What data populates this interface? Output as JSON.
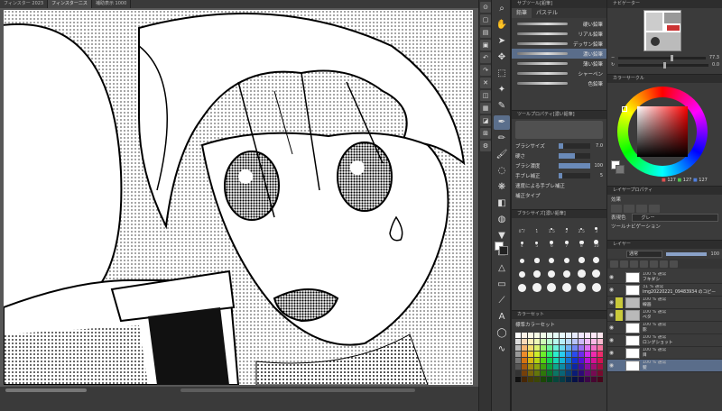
{
  "doc_tabs": [
    {
      "label": "フィンスター 2023"
    },
    {
      "label": "フィンスター二ス"
    },
    {
      "label": "補助表示 1000"
    }
  ],
  "subtool": {
    "header": "サブツール[鉛筆]",
    "tabs": [
      "鉛筆",
      "パステル"
    ],
    "brushes": [
      {
        "label": "硬い鉛筆"
      },
      {
        "label": "リアル鉛筆"
      },
      {
        "label": "デッサン鉛筆"
      },
      {
        "label": "濃い鉛筆"
      },
      {
        "label": "薄い鉛筆"
      },
      {
        "label": "シャーペン"
      },
      {
        "label": "色鉛筆"
      }
    ],
    "active_index": 3
  },
  "tool_property": {
    "header": "ツールプロパティ[濃い鉛筆]",
    "rows": [
      {
        "label": "ブラシサイズ",
        "value": "7.0",
        "fill": 0.15
      },
      {
        "label": "硬さ",
        "value": "",
        "fill": 0.5
      },
      {
        "label": "ブラシ濃度",
        "value": "100",
        "fill": 1.0
      },
      {
        "label": "手ブレ補正",
        "value": "5",
        "fill": 0.1
      },
      {
        "label": "速度による手ブレ補正",
        "value": "",
        "fill": 0
      },
      {
        "label": "補正タイプ",
        "value": "",
        "fill": 0
      }
    ]
  },
  "brush_size": {
    "header": "ブラシサイズ[濃い鉛筆]",
    "sizes": [
      "0.7",
      "1",
      "1.5",
      "2",
      "2.5",
      "3",
      "4",
      "5",
      "6",
      "7",
      "8",
      "10",
      "12",
      "15",
      "17",
      "20",
      "25",
      "30",
      "40",
      "50",
      "60",
      "70",
      "80",
      "100",
      "120",
      "150",
      "170",
      "200",
      "250",
      "300"
    ]
  },
  "color_set": {
    "header": "カラーセット",
    "name": "標準カラーセット"
  },
  "navigator": {
    "header": "ナビゲーター",
    "zoom": "77.3",
    "rotation": "0.0"
  },
  "color_wheel": {
    "header": "カラーサークル",
    "r": "127",
    "g": "127",
    "b": "127"
  },
  "layer_property": {
    "header": "レイヤープロパティ",
    "effect_label": "効果",
    "expression_label": "表現色",
    "expression_value": "グレー",
    "gradation_label": "ツールナビゲーション"
  },
  "layers": {
    "header": "レイヤー",
    "blend_mode": "通常",
    "opacity": "100",
    "items": [
      {
        "mode": "100 % 通常",
        "name": "フキダシ",
        "type": "layer",
        "selected": false
      },
      {
        "mode": "31 % 通常",
        "name": "img20220221_09483934 のコピー",
        "type": "image",
        "selected": false
      },
      {
        "mode": "100 % 通常",
        "name": "線画",
        "type": "folder",
        "selected": false
      },
      {
        "mode": "100 % 通常",
        "name": "ベタ",
        "type": "folder",
        "selected": false
      },
      {
        "mode": "100 % 通常",
        "name": "影",
        "type": "layer",
        "selected": false
      },
      {
        "mode": "100 % 通常",
        "name": "ロングショット",
        "type": "layer",
        "selected": false
      },
      {
        "mode": "100 % 通常",
        "name": "目",
        "type": "layer",
        "selected": false
      },
      {
        "mode": "100 % 通常",
        "name": "髪",
        "type": "layer",
        "selected": true
      }
    ]
  }
}
